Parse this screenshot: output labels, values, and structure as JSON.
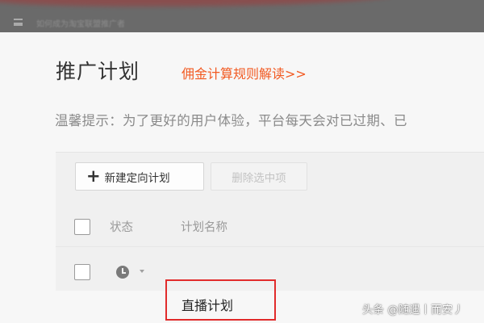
{
  "header": {
    "notice_text": "如何成为淘宝联盟推广者"
  },
  "page": {
    "title": "推广计划",
    "rule_link": "佣金计算规则解读>>",
    "tip": "温馨提示：为了更好的用户体验，平台每天会对已过期、已"
  },
  "toolbar": {
    "new_plan_label": "新建定向计划",
    "delete_selected_label": "删除选中项"
  },
  "table": {
    "columns": [
      "状态",
      "计划名称"
    ],
    "rows": [
      {
        "status_icon": "clock-icon",
        "name": "直播计划"
      }
    ]
  },
  "watermark": "头条 @随遇丨而安丿",
  "colors": {
    "accent_link": "#f25a22",
    "highlight_border": "#e12b2b"
  }
}
